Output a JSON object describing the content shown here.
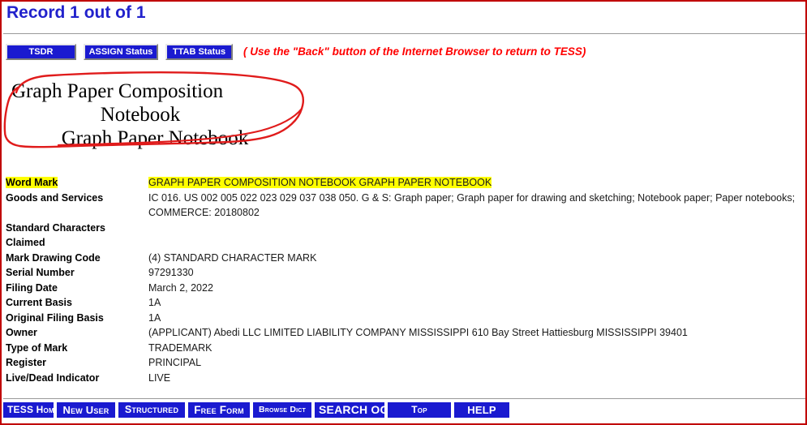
{
  "header": {
    "title": "Record 1 out of 1"
  },
  "toolbar": {
    "buttons": [
      {
        "label": "TSDR",
        "name": "tsdr-button"
      },
      {
        "label": "ASSIGN Status",
        "name": "assign-status-button"
      },
      {
        "label": "TTAB Status",
        "name": "ttab-status-button"
      }
    ],
    "back_note": "( Use the \"Back\" button of the Internet Browser to return to TESS)"
  },
  "mark_display": {
    "lines": [
      "Graph Paper Composition",
      "Notebook",
      "Graph Paper Notebook"
    ],
    "annotation": "red-hand-drawn-circle"
  },
  "colors": {
    "title_blue": "#2222cc",
    "button_blue": "#1a1ad0",
    "note_red": "#ff0000",
    "border_red": "#c00000",
    "highlight_yellow": "#ffff00"
  },
  "record": {
    "rows": [
      {
        "label": "Word Mark",
        "value": "GRAPH PAPER COMPOSITION NOTEBOOK GRAPH PAPER NOTEBOOK",
        "highlight": true
      },
      {
        "label": "Goods and Services",
        "value_line1": "IC 016. US 002 005 022 023 029 037 038 050. G & S: Graph paper; Graph paper for drawing and sketching; Notebook paper; Paper notebooks;",
        "value_line2": "COMMERCE: 20180802",
        "highlight": false
      },
      {
        "label": "Standard Characters Claimed",
        "value": "",
        "highlight": false
      },
      {
        "label": "Mark Drawing Code",
        "value": "(4) STANDARD CHARACTER MARK",
        "highlight": false
      },
      {
        "label": "Serial Number",
        "value": "97291330",
        "highlight": false
      },
      {
        "label": "Filing Date",
        "value": "March 2, 2022",
        "highlight": false
      },
      {
        "label": "Current Basis",
        "value": "1A",
        "highlight": false
      },
      {
        "label": "Original Filing Basis",
        "value": "1A",
        "highlight": false
      },
      {
        "label": "Owner",
        "value": "(APPLICANT) Abedi LLC LIMITED LIABILITY COMPANY MISSISSIPPI 610 Bay Street Hattiesburg MISSISSIPPI 39401",
        "highlight": false
      },
      {
        "label": "Type of Mark",
        "value": "TRADEMARK",
        "highlight": false
      },
      {
        "label": "Register",
        "value": "PRINCIPAL",
        "highlight": false
      },
      {
        "label": "Live/Dead Indicator",
        "value": "LIVE",
        "highlight": false
      }
    ]
  },
  "bottom_nav": {
    "buttons": [
      {
        "label": "TESS Home",
        "name": "tess-home-button"
      },
      {
        "label": "New User",
        "name": "new-user-button"
      },
      {
        "label": "Structured",
        "name": "structured-button"
      },
      {
        "label": "Free Form",
        "name": "free-form-button"
      },
      {
        "label": "Browse Dict",
        "name": "browse-dict-button"
      },
      {
        "label": "SEARCH OG",
        "name": "search-og-button"
      },
      {
        "label": "Top",
        "name": "top-button"
      },
      {
        "label": "HELP",
        "name": "help-button"
      }
    ]
  }
}
